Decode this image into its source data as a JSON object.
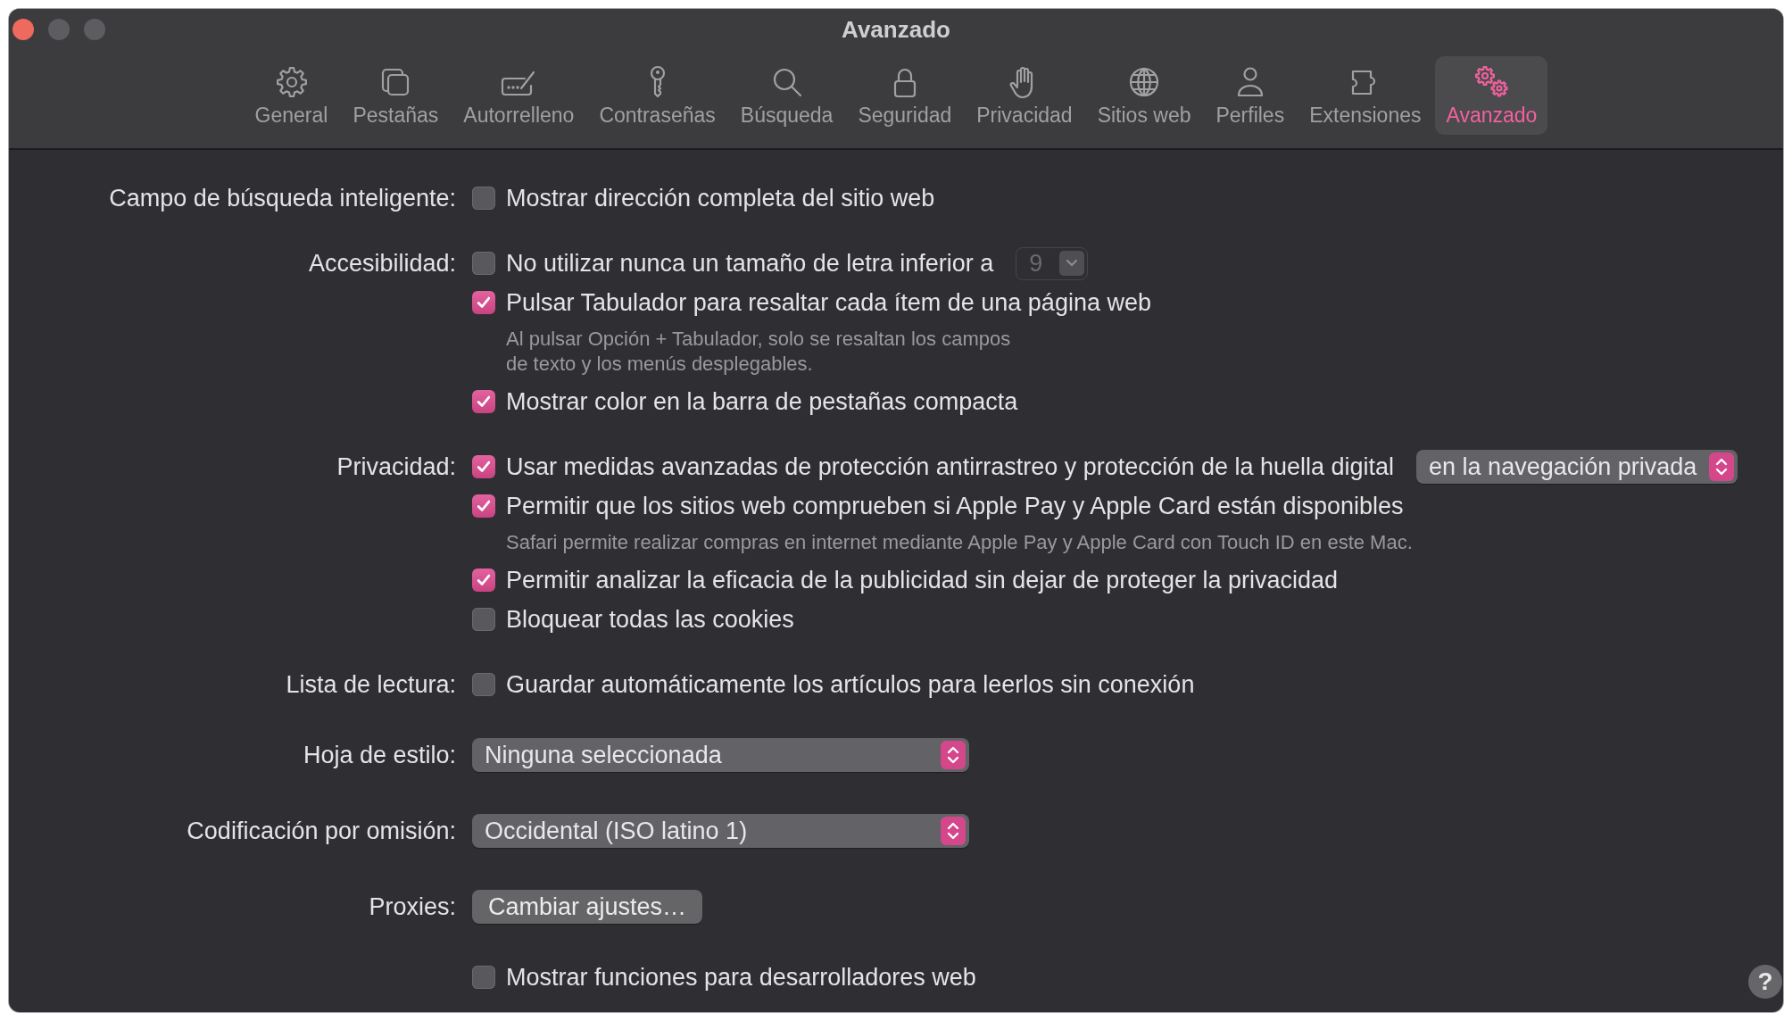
{
  "window": {
    "title": "Avanzado",
    "controls": [
      {
        "kind": "close",
        "enabled": true
      },
      {
        "kind": "minimize",
        "enabled": false
      },
      {
        "kind": "zoom",
        "enabled": false
      }
    ]
  },
  "toolbar": {
    "tabs": [
      {
        "label": "General",
        "selected": false
      },
      {
        "label": "Pestañas",
        "selected": false
      },
      {
        "label": "Autorrelleno",
        "selected": false
      },
      {
        "label": "Contraseñas",
        "selected": false
      },
      {
        "label": "Búsqueda",
        "selected": false
      },
      {
        "label": "Seguridad",
        "selected": false
      },
      {
        "label": "Privacidad",
        "selected": false
      },
      {
        "label": "Sitios web",
        "selected": false
      },
      {
        "label": "Perfiles",
        "selected": false
      },
      {
        "label": "Extensiones",
        "selected": false
      },
      {
        "label": "Avanzado",
        "selected": true
      }
    ]
  },
  "settings": [
    {
      "label": "Campo de búsqueda inteligente:",
      "items": [
        {
          "kind": "checkbox",
          "text": "Mostrar dirección completa del sitio web",
          "checked": false
        }
      ]
    },
    {
      "label": "Accesibilidad:",
      "items": [
        {
          "kind": "checkbox",
          "text": "No utilizar nunca un tamaño de letra inferior a",
          "checked": false,
          "popup": {
            "kind": "combo",
            "value": "9",
            "disabled": true
          }
        },
        {
          "kind": "checkbox",
          "text": "Pulsar Tabulador para resaltar cada ítem de una página web",
          "checked": true,
          "note": [
            "Al pulsar Opción + Tabulador, solo se resaltan los campos",
            "de texto y los menús desplegables."
          ]
        },
        {
          "kind": "checkbox",
          "text": "Mostrar color en la barra de pestañas compacta",
          "checked": true
        }
      ]
    },
    {
      "label": "Privacidad:",
      "items": [
        {
          "kind": "checkbox",
          "text": "Usar medidas avanzadas de protección antirrastreo y protección de la huella digital",
          "checked": true,
          "popup": {
            "kind": "select",
            "value": "en la navegación privada"
          }
        },
        {
          "kind": "checkbox",
          "text": "Permitir que los sitios web comprueben si Apple Pay y Apple Card están disponibles",
          "checked": true,
          "note": [
            "Safari permite realizar compras en internet mediante Apple Pay y Apple Card con Touch ID en este Mac."
          ]
        },
        {
          "kind": "checkbox",
          "text": "Permitir analizar la eficacia de la publicidad sin dejar de proteger la privacidad",
          "checked": true
        },
        {
          "kind": "checkbox",
          "text": "Bloquear todas las cookies",
          "checked": false
        }
      ]
    },
    {
      "label": "Lista de lectura:",
      "items": [
        {
          "kind": "checkbox",
          "text": "Guardar automáticamente los artículos para leerlos sin conexión",
          "checked": false
        }
      ]
    },
    {
      "label": "Hoja de estilo:",
      "items": [
        {
          "kind": "select",
          "value": "Ninguna seleccionada"
        }
      ]
    },
    {
      "label": "Codificación por omisión:",
      "items": [
        {
          "kind": "select",
          "value": "Occidental (ISO latino 1)"
        }
      ]
    },
    {
      "label": "Proxies:",
      "items": [
        {
          "kind": "button",
          "text": "Cambiar ajustes…"
        }
      ]
    },
    {
      "items": [
        {
          "kind": "checkbox",
          "text": "Mostrar funciones para desarrolladores web",
          "checked": false
        }
      ]
    }
  ],
  "help_button": {
    "label": "?"
  }
}
